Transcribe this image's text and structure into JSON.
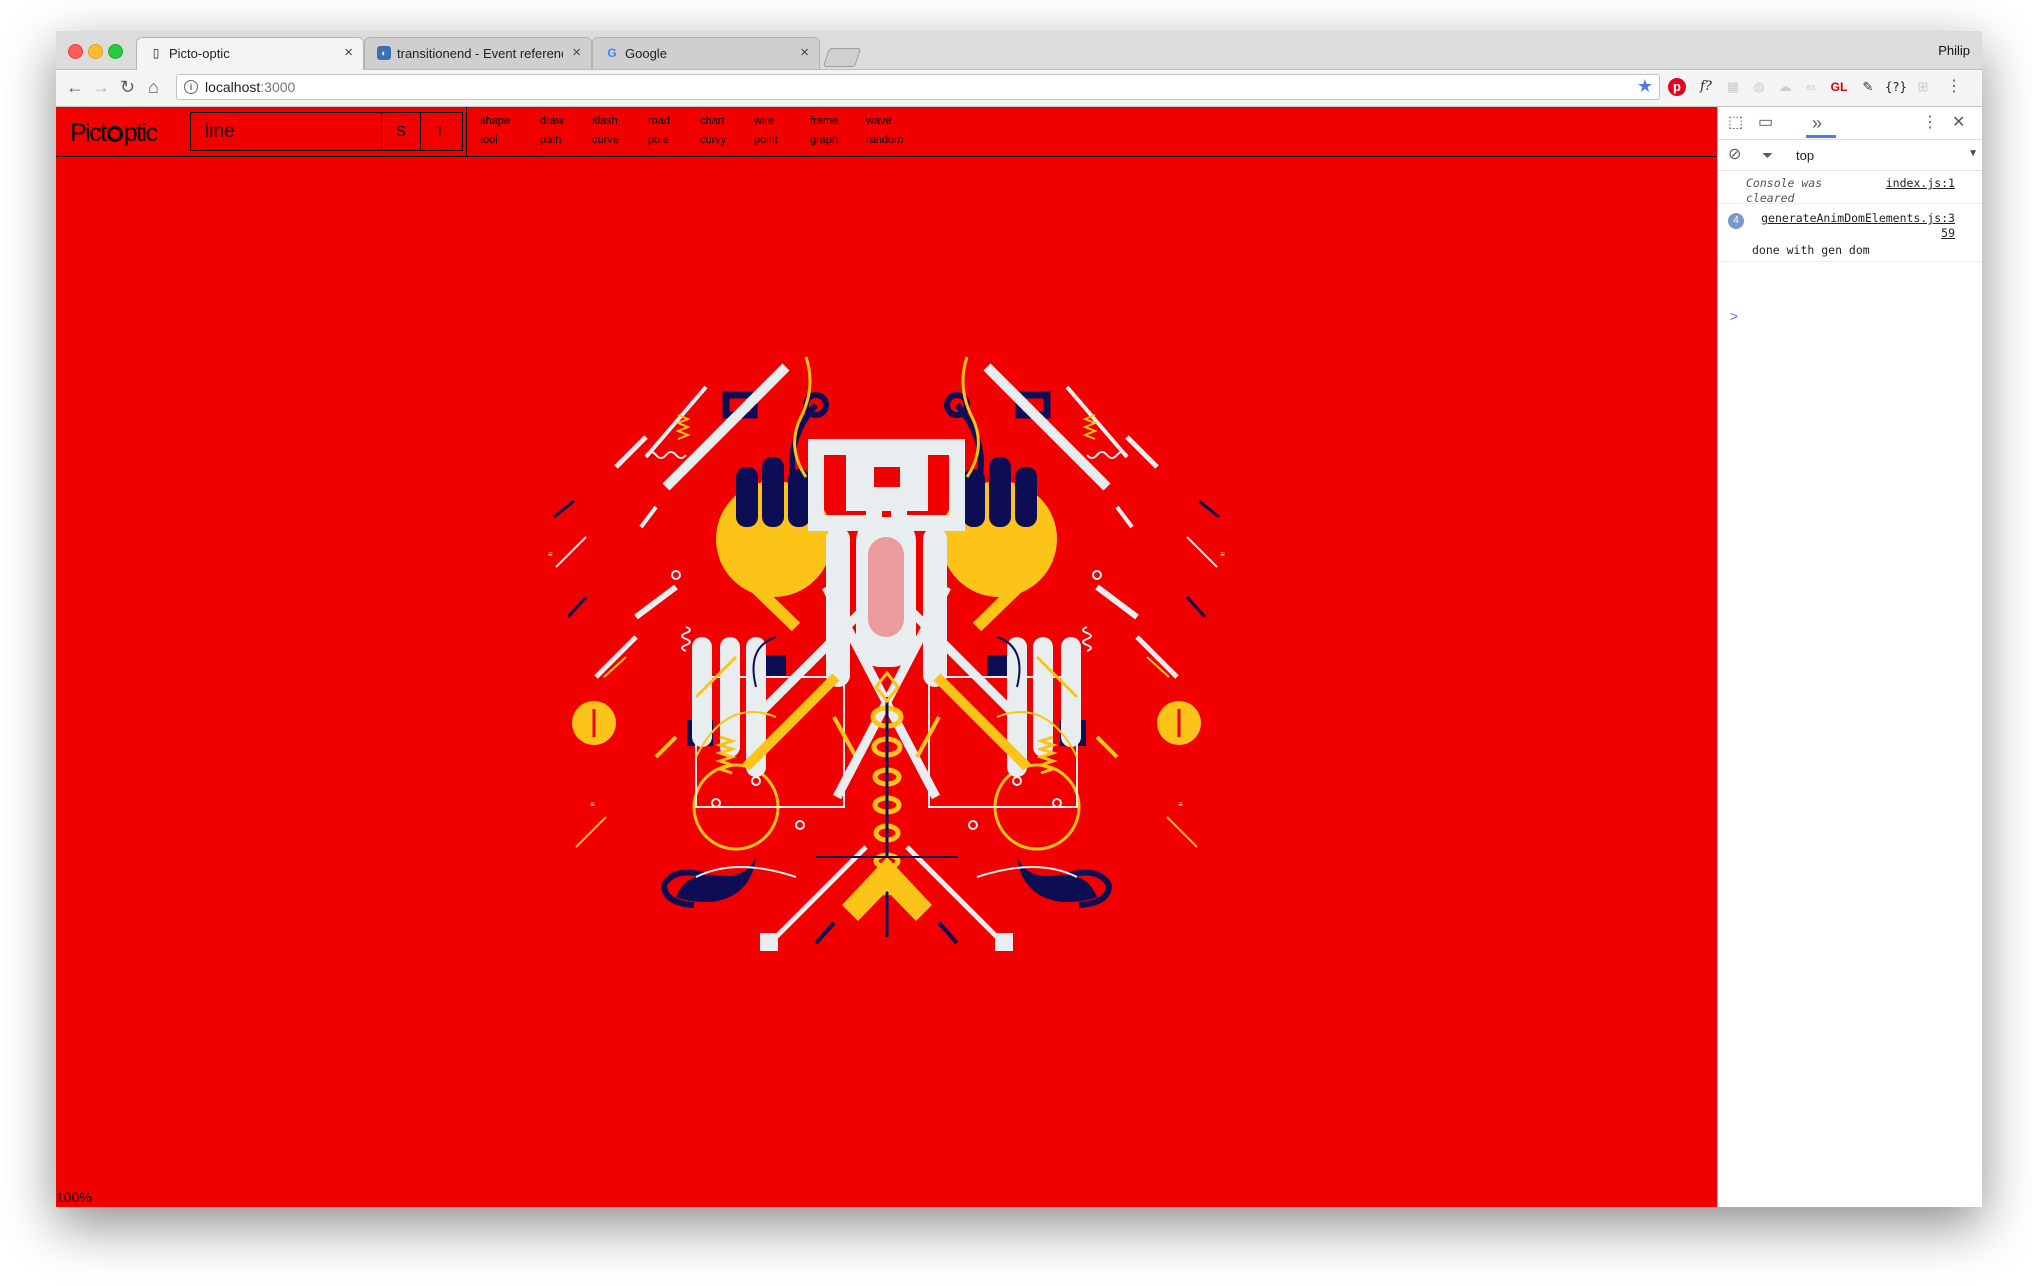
{
  "browser": {
    "tabs": [
      {
        "title": "Picto-optic",
        "favicon": "page-icon",
        "active": true
      },
      {
        "title": "transitionend - Event reference",
        "favicon": "mdn-icon",
        "active": false
      },
      {
        "title": "Google",
        "favicon": "google-icon",
        "active": false
      }
    ],
    "profile": "Philip",
    "address": {
      "host": "localhost",
      "port": ":3000"
    },
    "extensions": [
      "pinterest-icon",
      "f?",
      "GL",
      "{?}"
    ]
  },
  "app": {
    "logo": {
      "part1": "Pict",
      "part2": "ptic"
    },
    "search": {
      "value": "line",
      "btn_s": "S",
      "btn_excl": "!"
    },
    "menu": [
      [
        "shape",
        "tool"
      ],
      [
        "draw",
        "path"
      ],
      [
        "slash",
        "curve"
      ],
      [
        "road",
        "pole"
      ],
      [
        "chart",
        "curvy"
      ],
      [
        "wire",
        "point"
      ],
      [
        "frame",
        "graph"
      ],
      [
        "wave",
        "random"
      ]
    ],
    "zoom": "100%",
    "colors": {
      "background": "#f20000",
      "yellow": "#fcc419",
      "navy": "#0d0d55",
      "white": "#e8eef0"
    }
  },
  "devtools": {
    "context": "top",
    "messages": [
      {
        "text": "Console was cleared",
        "source": "index.js:1",
        "italic": true
      },
      {
        "count": "4",
        "source": "generateAnimDomElements.js:359",
        "text": "done with gen dom"
      }
    ],
    "prompt": ">"
  }
}
